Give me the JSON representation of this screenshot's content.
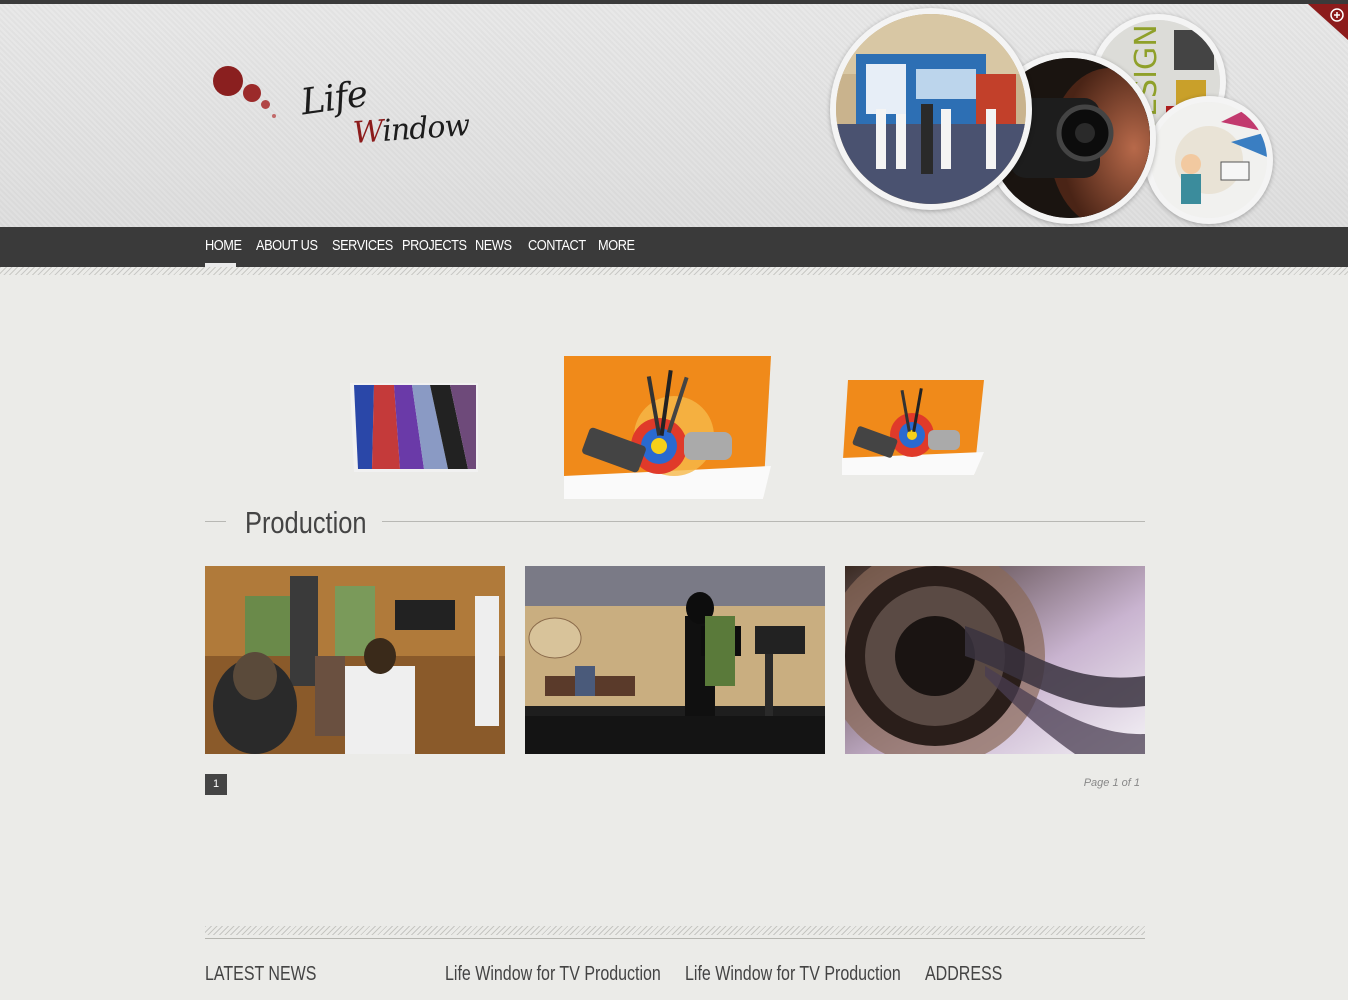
{
  "brand": {
    "logo_text_line1": "Life",
    "logo_text_line2": "Window",
    "accent": "#8c1b1b"
  },
  "nav": {
    "items": [
      {
        "label": "HOME"
      },
      {
        "label": "ABOUT US"
      },
      {
        "label": "SERVICES"
      },
      {
        "label": "PROJECTS"
      },
      {
        "label": "NEWS"
      },
      {
        "label": "CONTACT"
      },
      {
        "label": "MORE"
      }
    ],
    "active": "HOME"
  },
  "header_circles": [
    {
      "name": "exhibition-photo"
    },
    {
      "name": "camera-operator-photo"
    },
    {
      "name": "design-collage-photo",
      "text": "DESIGN"
    },
    {
      "name": "illustration-photo"
    }
  ],
  "corner_icon": "plus-icon",
  "slider": {
    "slides": [
      {
        "name": "color-panels-image"
      },
      {
        "name": "design-tools-image"
      },
      {
        "name": "design-tools-image"
      }
    ]
  },
  "section": {
    "title": "Production"
  },
  "gallery": [
    {
      "name": "tv-studio-crew-photo"
    },
    {
      "name": "tv-talk-show-set-photo"
    },
    {
      "name": "film-reel-photo"
    }
  ],
  "pagination": {
    "current": "1",
    "info": "Page 1 of 1"
  },
  "footer": {
    "columns": [
      {
        "title": "LATEST NEWS"
      },
      {
        "title": "Life Window for TV Production"
      },
      {
        "title": "Life Window for TV Production"
      },
      {
        "title": "ADDRESS"
      }
    ]
  }
}
